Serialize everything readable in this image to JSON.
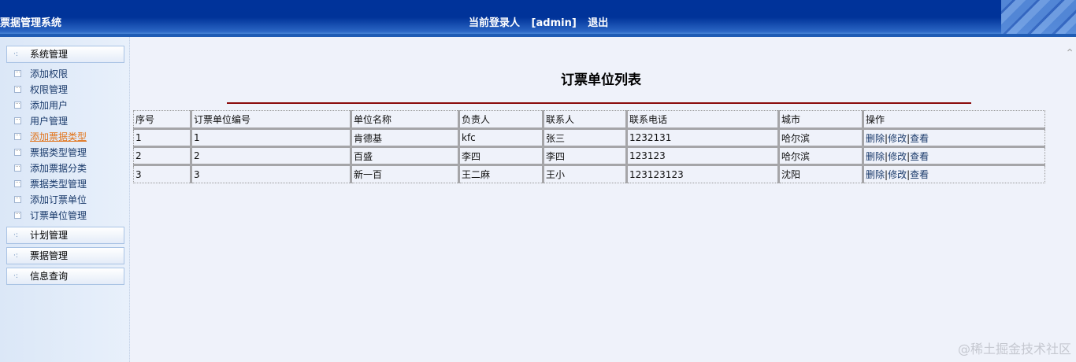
{
  "header": {
    "system_title": "票据管理系统",
    "login_label": "当前登录人",
    "user": "[admin]",
    "logout": "退出"
  },
  "sidebar": {
    "groups": [
      {
        "label": "系统管理"
      },
      {
        "label": "计划管理"
      },
      {
        "label": "票据管理"
      },
      {
        "label": "信息查询"
      }
    ],
    "items": [
      {
        "label": "添加权限"
      },
      {
        "label": "权限管理"
      },
      {
        "label": "添加用户"
      },
      {
        "label": "用户管理"
      },
      {
        "label": "添加票据类型"
      },
      {
        "label": "票据类型管理"
      },
      {
        "label": "添加票据分类"
      },
      {
        "label": "票据类型管理"
      },
      {
        "label": "添加订票单位"
      },
      {
        "label": "订票单位管理"
      }
    ],
    "active_index": 4
  },
  "main": {
    "title": "订票单位列表",
    "columns": [
      "序号",
      "订票单位编号",
      "单位名称",
      "负责人",
      "联系人",
      "联系电话",
      "城市",
      "操作"
    ],
    "rows": [
      [
        "1",
        "1",
        "肯德基",
        "kfc",
        "张三",
        "1232131",
        "哈尔滨"
      ],
      [
        "2",
        "2",
        "百盛",
        "李四",
        "李四",
        "123123",
        "哈尔滨"
      ],
      [
        "3",
        "3",
        "新一百",
        "王二麻",
        "王小",
        "123123123",
        "沈阳"
      ]
    ],
    "actions": {
      "delete": "删除",
      "edit": "修改",
      "view": "查看",
      "sep": "|"
    }
  },
  "watermark": "@稀土掘金技术社区"
}
